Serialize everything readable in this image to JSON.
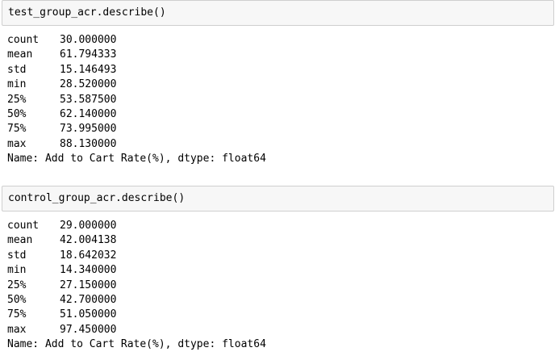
{
  "cells": [
    {
      "input": "test_group_acr.describe()",
      "rows": [
        {
          "stat": "count",
          "value": "30.000000"
        },
        {
          "stat": "mean",
          "value": "61.794333"
        },
        {
          "stat": "std",
          "value": "15.146493"
        },
        {
          "stat": "min",
          "value": "28.520000"
        },
        {
          "stat": "25%",
          "value": "53.587500"
        },
        {
          "stat": "50%",
          "value": "62.140000"
        },
        {
          "stat": "75%",
          "value": "73.995000"
        },
        {
          "stat": "max",
          "value": "88.130000"
        }
      ],
      "footer": "Name: Add to Cart Rate(%), dtype: float64"
    },
    {
      "input": "control_group_acr.describe()",
      "rows": [
        {
          "stat": "count",
          "value": "29.000000"
        },
        {
          "stat": "mean",
          "value": "42.004138"
        },
        {
          "stat": "std",
          "value": "18.642032"
        },
        {
          "stat": "min",
          "value": "14.340000"
        },
        {
          "stat": "25%",
          "value": "27.150000"
        },
        {
          "stat": "50%",
          "value": "42.700000"
        },
        {
          "stat": "75%",
          "value": "51.050000"
        },
        {
          "stat": "max",
          "value": "97.450000"
        }
      ],
      "footer": "Name: Add to Cart Rate(%), dtype: float64"
    }
  ],
  "colors": {
    "input_background": "#f7f7f7",
    "input_border": "#cfcfcf",
    "text": "#000000"
  }
}
